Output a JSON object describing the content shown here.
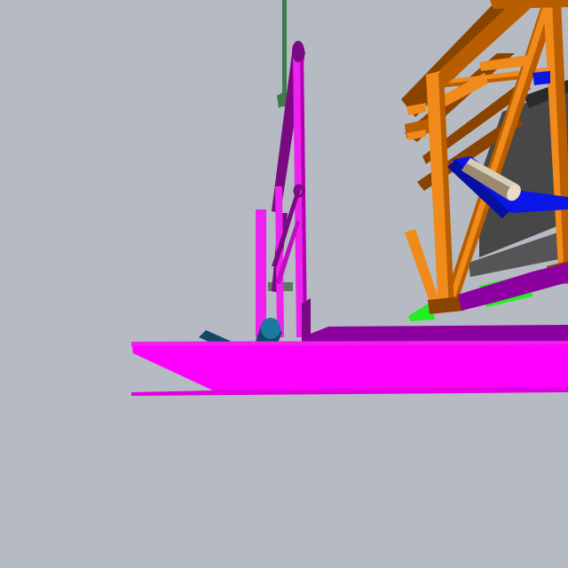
{
  "scene": {
    "background_color": "#b6bac3",
    "colors": {
      "platform": "#ff00ff",
      "platform_shadow": "#9a009a",
      "platform_lower": "#e000e0",
      "magenta_structure": "#ee22ee",
      "dark_purple": "#7a0a82",
      "cable": "#3f7a4a",
      "orange_frame": "#f08a1a",
      "orange_dark": "#b85e00",
      "orange_shadow": "#8a4400",
      "blue_support": "#0a16e6",
      "blue_dark": "#0610a0",
      "cylinder_light": "#e6dcc8",
      "cylinder_dark": "#9a8a70",
      "gray_panel": "#474747",
      "green_panel": "#22ee22",
      "teal_object": "#1a7aa0",
      "teal_dark": "#0e4a66",
      "deck_purple": "#8c00a0"
    },
    "objects": [
      "platform",
      "magenta-tower",
      "vertical-cable",
      "orange-truss-frame",
      "blue-support-arm",
      "beige-cylinder",
      "gray-panel",
      "green-panel",
      "teal-cylinder"
    ]
  }
}
